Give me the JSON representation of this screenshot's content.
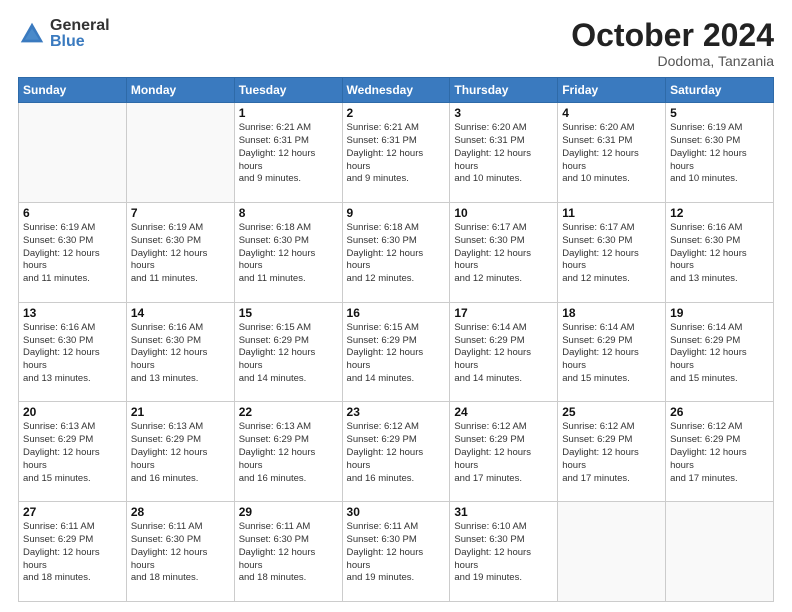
{
  "logo": {
    "general": "General",
    "blue": "Blue"
  },
  "header": {
    "month": "October 2024",
    "location": "Dodoma, Tanzania"
  },
  "weekdays": [
    "Sunday",
    "Monday",
    "Tuesday",
    "Wednesday",
    "Thursday",
    "Friday",
    "Saturday"
  ],
  "days": [
    {
      "date": "",
      "sunrise": "",
      "sunset": "",
      "daylight": ""
    },
    {
      "date": "",
      "sunrise": "",
      "sunset": "",
      "daylight": ""
    },
    {
      "date": "1",
      "sunrise": "Sunrise: 6:21 AM",
      "sunset": "Sunset: 6:31 PM",
      "daylight": "Daylight: 12 hours and 9 minutes."
    },
    {
      "date": "2",
      "sunrise": "Sunrise: 6:21 AM",
      "sunset": "Sunset: 6:31 PM",
      "daylight": "Daylight: 12 hours and 9 minutes."
    },
    {
      "date": "3",
      "sunrise": "Sunrise: 6:20 AM",
      "sunset": "Sunset: 6:31 PM",
      "daylight": "Daylight: 12 hours and 10 minutes."
    },
    {
      "date": "4",
      "sunrise": "Sunrise: 6:20 AM",
      "sunset": "Sunset: 6:31 PM",
      "daylight": "Daylight: 12 hours and 10 minutes."
    },
    {
      "date": "5",
      "sunrise": "Sunrise: 6:19 AM",
      "sunset": "Sunset: 6:30 PM",
      "daylight": "Daylight: 12 hours and 10 minutes."
    },
    {
      "date": "6",
      "sunrise": "Sunrise: 6:19 AM",
      "sunset": "Sunset: 6:30 PM",
      "daylight": "Daylight: 12 hours and 11 minutes."
    },
    {
      "date": "7",
      "sunrise": "Sunrise: 6:19 AM",
      "sunset": "Sunset: 6:30 PM",
      "daylight": "Daylight: 12 hours and 11 minutes."
    },
    {
      "date": "8",
      "sunrise": "Sunrise: 6:18 AM",
      "sunset": "Sunset: 6:30 PM",
      "daylight": "Daylight: 12 hours and 11 minutes."
    },
    {
      "date": "9",
      "sunrise": "Sunrise: 6:18 AM",
      "sunset": "Sunset: 6:30 PM",
      "daylight": "Daylight: 12 hours and 12 minutes."
    },
    {
      "date": "10",
      "sunrise": "Sunrise: 6:17 AM",
      "sunset": "Sunset: 6:30 PM",
      "daylight": "Daylight: 12 hours and 12 minutes."
    },
    {
      "date": "11",
      "sunrise": "Sunrise: 6:17 AM",
      "sunset": "Sunset: 6:30 PM",
      "daylight": "Daylight: 12 hours and 12 minutes."
    },
    {
      "date": "12",
      "sunrise": "Sunrise: 6:16 AM",
      "sunset": "Sunset: 6:30 PM",
      "daylight": "Daylight: 12 hours and 13 minutes."
    },
    {
      "date": "13",
      "sunrise": "Sunrise: 6:16 AM",
      "sunset": "Sunset: 6:30 PM",
      "daylight": "Daylight: 12 hours and 13 minutes."
    },
    {
      "date": "14",
      "sunrise": "Sunrise: 6:16 AM",
      "sunset": "Sunset: 6:30 PM",
      "daylight": "Daylight: 12 hours and 13 minutes."
    },
    {
      "date": "15",
      "sunrise": "Sunrise: 6:15 AM",
      "sunset": "Sunset: 6:29 PM",
      "daylight": "Daylight: 12 hours and 14 minutes."
    },
    {
      "date": "16",
      "sunrise": "Sunrise: 6:15 AM",
      "sunset": "Sunset: 6:29 PM",
      "daylight": "Daylight: 12 hours and 14 minutes."
    },
    {
      "date": "17",
      "sunrise": "Sunrise: 6:14 AM",
      "sunset": "Sunset: 6:29 PM",
      "daylight": "Daylight: 12 hours and 14 minutes."
    },
    {
      "date": "18",
      "sunrise": "Sunrise: 6:14 AM",
      "sunset": "Sunset: 6:29 PM",
      "daylight": "Daylight: 12 hours and 15 minutes."
    },
    {
      "date": "19",
      "sunrise": "Sunrise: 6:14 AM",
      "sunset": "Sunset: 6:29 PM",
      "daylight": "Daylight: 12 hours and 15 minutes."
    },
    {
      "date": "20",
      "sunrise": "Sunrise: 6:13 AM",
      "sunset": "Sunset: 6:29 PM",
      "daylight": "Daylight: 12 hours and 15 minutes."
    },
    {
      "date": "21",
      "sunrise": "Sunrise: 6:13 AM",
      "sunset": "Sunset: 6:29 PM",
      "daylight": "Daylight: 12 hours and 16 minutes."
    },
    {
      "date": "22",
      "sunrise": "Sunrise: 6:13 AM",
      "sunset": "Sunset: 6:29 PM",
      "daylight": "Daylight: 12 hours and 16 minutes."
    },
    {
      "date": "23",
      "sunrise": "Sunrise: 6:12 AM",
      "sunset": "Sunset: 6:29 PM",
      "daylight": "Daylight: 12 hours and 16 minutes."
    },
    {
      "date": "24",
      "sunrise": "Sunrise: 6:12 AM",
      "sunset": "Sunset: 6:29 PM",
      "daylight": "Daylight: 12 hours and 17 minutes."
    },
    {
      "date": "25",
      "sunrise": "Sunrise: 6:12 AM",
      "sunset": "Sunset: 6:29 PM",
      "daylight": "Daylight: 12 hours and 17 minutes."
    },
    {
      "date": "26",
      "sunrise": "Sunrise: 6:12 AM",
      "sunset": "Sunset: 6:29 PM",
      "daylight": "Daylight: 12 hours and 17 minutes."
    },
    {
      "date": "27",
      "sunrise": "Sunrise: 6:11 AM",
      "sunset": "Sunset: 6:29 PM",
      "daylight": "Daylight: 12 hours and 18 minutes."
    },
    {
      "date": "28",
      "sunrise": "Sunrise: 6:11 AM",
      "sunset": "Sunset: 6:30 PM",
      "daylight": "Daylight: 12 hours and 18 minutes."
    },
    {
      "date": "29",
      "sunrise": "Sunrise: 6:11 AM",
      "sunset": "Sunset: 6:30 PM",
      "daylight": "Daylight: 12 hours and 18 minutes."
    },
    {
      "date": "30",
      "sunrise": "Sunrise: 6:11 AM",
      "sunset": "Sunset: 6:30 PM",
      "daylight": "Daylight: 12 hours and 19 minutes."
    },
    {
      "date": "31",
      "sunrise": "Sunrise: 6:10 AM",
      "sunset": "Sunset: 6:30 PM",
      "daylight": "Daylight: 12 hours and 19 minutes."
    },
    {
      "date": "",
      "sunrise": "",
      "sunset": "",
      "daylight": ""
    },
    {
      "date": "",
      "sunrise": "",
      "sunset": "",
      "daylight": ""
    }
  ]
}
